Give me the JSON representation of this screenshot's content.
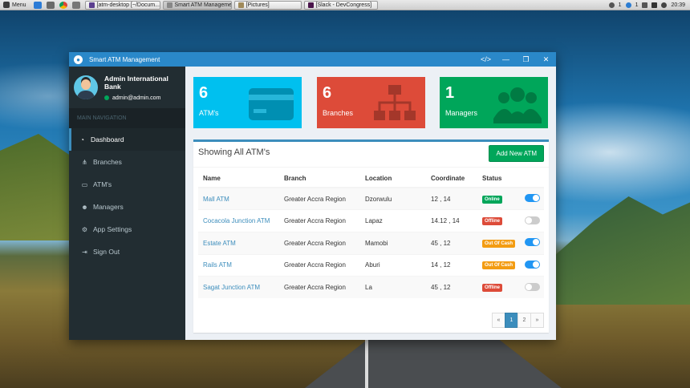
{
  "taskbar": {
    "menu_label": "Menu",
    "tasks": [
      {
        "label": "[atm-desktop [~/Docum...",
        "icon": "terminal-icon",
        "color": "#5b3f8f"
      },
      {
        "label": "Smart ATM Management",
        "icon": "app-window-icon",
        "color": "#888888"
      },
      {
        "label": "[Pictures]",
        "icon": "folder-icon",
        "color": "#a08a5a"
      },
      {
        "label": "[Slack - DevCongress]",
        "icon": "slack-icon",
        "color": "#4a154b"
      }
    ],
    "tray_count_1": "1",
    "tray_count_2": "1",
    "clock": "20:39"
  },
  "window": {
    "title": "Smart ATM Management",
    "accent": "#2a88c9"
  },
  "sidebar": {
    "user_name": "Admin International Bank",
    "user_email": "admin@admin.com",
    "nav_header": "MAIN NAVIGATION",
    "items": [
      {
        "label": "Dashboard",
        "icon": "dashboard-icon",
        "glyph": "◔",
        "active": true
      },
      {
        "label": "Branches",
        "icon": "sitemap-icon",
        "glyph": "⋔",
        "active": false
      },
      {
        "label": "ATM's",
        "icon": "credit-card-icon",
        "glyph": "▭",
        "active": false
      },
      {
        "label": "Managers",
        "icon": "users-icon",
        "glyph": "☻",
        "active": false
      },
      {
        "label": "App Settings",
        "icon": "cogs-icon",
        "glyph": "⚙",
        "active": false
      },
      {
        "label": "Sign Out",
        "icon": "sign-out-icon",
        "glyph": "⇥",
        "active": false
      }
    ]
  },
  "stats": [
    {
      "number": "6",
      "label": "ATM's",
      "color": "#00c0ef",
      "icon": "credit-card-icon"
    },
    {
      "number": "6",
      "label": "Branches",
      "color": "#dd4b39",
      "icon": "sitemap-icon"
    },
    {
      "number": "1",
      "label": "Managers",
      "color": "#00a65a",
      "icon": "users-icon"
    }
  ],
  "panel": {
    "title": "Showing All ATM's",
    "add_button": "Add New ATM",
    "headers": [
      "Name",
      "Branch",
      "Location",
      "Coordinate",
      "Status"
    ],
    "rows": [
      {
        "name": "Mall ATM",
        "branch": "Greater Accra Region",
        "location": "Dzorwulu",
        "coordinate": "12 , 14",
        "status": "Online",
        "status_color": "#00a65a",
        "enabled": true
      },
      {
        "name": "Cocacola Junction ATM",
        "branch": "Greater Accra Region",
        "location": "Lapaz",
        "coordinate": "14.12 , 14",
        "status": "Offline",
        "status_color": "#dd4b39",
        "enabled": false
      },
      {
        "name": "Estate ATM",
        "branch": "Greater Accra Region",
        "location": "Mamobi",
        "coordinate": "45 , 12",
        "status": "Out Of Cash",
        "status_color": "#f39c12",
        "enabled": true
      },
      {
        "name": "Rails ATM",
        "branch": "Greater Accra Region",
        "location": "Aburi",
        "coordinate": "14 , 12",
        "status": "Out Of Cash",
        "status_color": "#f39c12",
        "enabled": true
      },
      {
        "name": "Sagat Junction ATM",
        "branch": "Greater Accra Region",
        "location": "La",
        "coordinate": "45 , 12",
        "status": "Offline",
        "status_color": "#dd4b39",
        "enabled": false
      }
    ],
    "pagination": {
      "prev": "«",
      "pages": [
        "1",
        "2"
      ],
      "current": "1",
      "next": "»"
    }
  }
}
